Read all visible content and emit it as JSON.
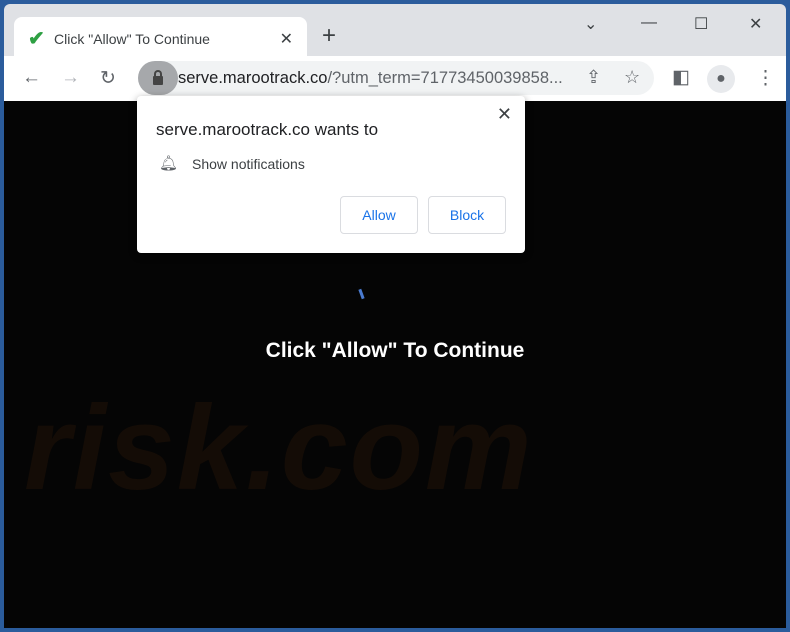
{
  "tab": {
    "title": "Click \"Allow\" To Continue",
    "icon": "checkmark-icon"
  },
  "address": {
    "host": "serve.marootrack.co",
    "path": "/?utm_term=71773450039858..."
  },
  "popup": {
    "heading": "serve.marootrack.co wants to",
    "permission": "Show notifications",
    "allow": "Allow",
    "block": "Block"
  },
  "page": {
    "message": "Click \"Allow\" To Continue",
    "watermark": "risk.com"
  },
  "colors": {
    "frame": "#2b5c9c",
    "accent": "#1a73e8",
    "page_bg": "#050505"
  }
}
